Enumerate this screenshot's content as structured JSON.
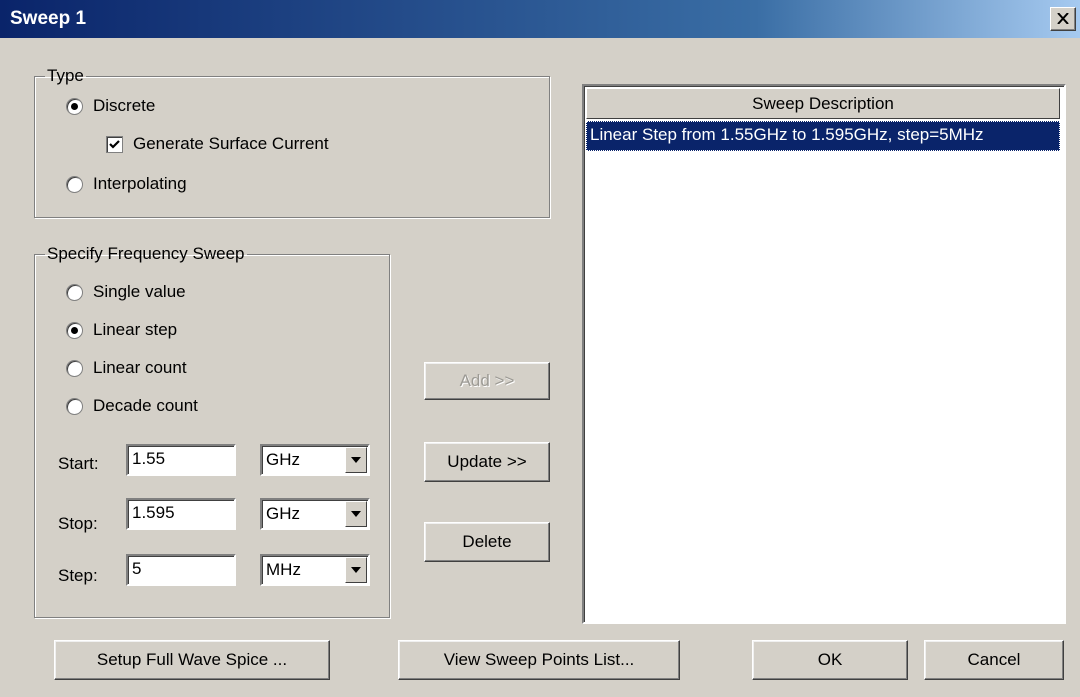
{
  "window": {
    "title": "Sweep 1"
  },
  "type_group": {
    "legend": "Type",
    "discrete": {
      "label": "Discrete",
      "selected": true
    },
    "surface_current": {
      "label": "Generate Surface Current",
      "checked": true
    },
    "interpolating": {
      "label": "Interpolating",
      "selected": false
    }
  },
  "freq_group": {
    "legend": "Specify Frequency Sweep",
    "options": [
      {
        "label": "Single value",
        "selected": false
      },
      {
        "label": "Linear step",
        "selected": true
      },
      {
        "label": "Linear count",
        "selected": false
      },
      {
        "label": "Decade count",
        "selected": false
      }
    ],
    "start": {
      "label": "Start:",
      "value": "1.55",
      "unit": "GHz"
    },
    "stop": {
      "label": "Stop:",
      "value": "1.595",
      "unit": "GHz"
    },
    "step": {
      "label": "Step:",
      "value": "5",
      "unit": "MHz"
    }
  },
  "middle_buttons": {
    "add": "Add >>",
    "update": "Update >>",
    "delete": "Delete"
  },
  "sweep_list": {
    "header": "Sweep Description",
    "rows": [
      "Linear Step from 1.55GHz to 1.595GHz, step=5MHz"
    ]
  },
  "bottom_buttons": {
    "setup": "Setup Full Wave Spice ...",
    "view": "View Sweep Points List...",
    "ok": "OK",
    "cancel": "Cancel"
  },
  "icons": {
    "close": "close-icon",
    "dropdown": "chevron-down-icon",
    "check": "checkmark-icon"
  }
}
